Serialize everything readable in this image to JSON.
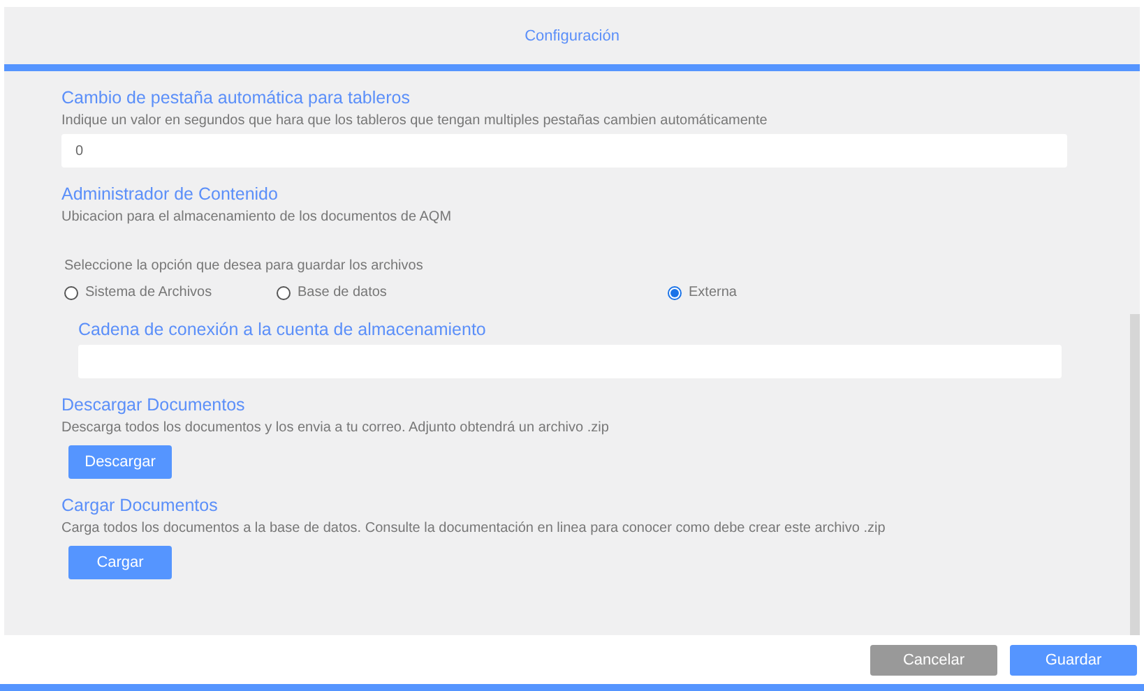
{
  "title": "Configuración",
  "sections": [
    {
      "kind": "input",
      "title": "Cambio de pestaña automática para tableros",
      "description": "Indique un valor en segundos que hara que los tableros que tengan multiples pestañas cambien automáticamente",
      "value": "0"
    },
    {
      "kind": "storage",
      "title": "Administrador de Contenido",
      "description": "Ubicacion para el almacenamiento de los documentos de AQM",
      "prompt": "Seleccione la opción que desea para guardar los archivos",
      "options": [
        {
          "label": "Sistema de Archivos",
          "selected": false
        },
        {
          "label": "Base de datos",
          "selected": false
        },
        {
          "label": "Externa",
          "selected": true
        }
      ],
      "sub_title": "Cadena de conexión a la cuenta de almacenamiento"
    },
    {
      "kind": "action",
      "title": "Descargar Documentos",
      "description": "Descarga todos los documentos y los envia a tu correo. Adjunto obtendrá un archivo .zip",
      "button": "Descargar"
    },
    {
      "kind": "action",
      "title": "Cargar Documentos",
      "description": "Carga todos los documentos a la base de datos. Consulte la documentación en linea para conocer como debe crear este archivo .zip",
      "button": "Cargar"
    }
  ],
  "buttons": [
    {
      "label": "Cancelar",
      "kind": "secondary"
    },
    {
      "label": "Guardar",
      "kind": "primary"
    }
  ]
}
